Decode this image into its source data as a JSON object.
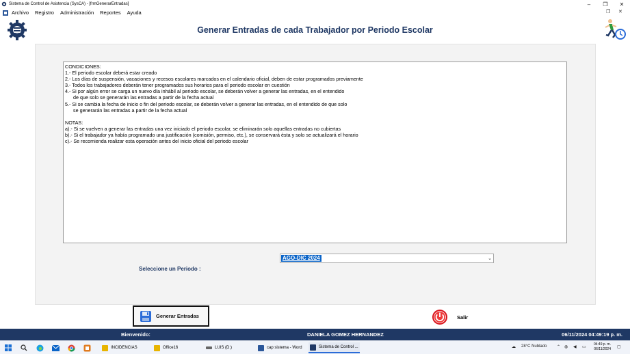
{
  "window": {
    "title": "Sistema de Control de Asistencia (SysCA) - [frmGenerarEntradas]",
    "icon": "app-icon",
    "controls": [
      "minimize-icon",
      "restore-icon",
      "close-icon"
    ]
  },
  "menu": {
    "items": [
      "Archivo",
      "Registro",
      "Administración",
      "Reportes",
      "Ayuda"
    ]
  },
  "header": {
    "title": "Generar Entradas de cada Trabajador por Periodo Escolar",
    "title_color": "#1f3864"
  },
  "conditions_text": "CONDICIONES:\n1.- El periodo escolar deberá estar creado\n2.- Los días de suspensión, vacaciones y recesos escolares marcados en el calendario oficial, deben de estar programados previamente\n3.- Todos los trabajadores deberán tener programados sus horarios para el periodo escolar en cuestión\n4.- Si por algún error se carga un nuevo día inhábil al periodo escolar, se deberán volver a generar las entradas, en el entendido\n      de que solo se generarán las entradas a partir de la fecha actual\n5.- Si se cambia la fecha de inicio o fin del periodo escolar, se deberán volver a generar las entradas, en el entendido de que solo\n      se generarán las entradas a partir de la fecha actual\n\nNOTAS:\na).- Si se vuelven a generar las entradas una vez iniciado el periodo escolar, se eliminarán solo aquellas entradas no cubiertas\nb).- Si el trabajador ya había programado una justificación (comisión, permiso, etc.), se conservará ésta y solo se actualizará el horario\nc).- Se recomienda realizar esta operación antes del inicio oficial del periodo escolar",
  "periodo": {
    "label": "Seleccione un Periodo :",
    "selected": "AGO-DIC 2024"
  },
  "buttons": {
    "generar": "Generar Entradas",
    "salir": "Salir"
  },
  "status": {
    "welcome_label": "Bienvenido:",
    "user": "DANIELA GOMEZ HERNANDEZ",
    "datetime": "06/11/2024 04:49:19 p. m."
  },
  "taskbar": {
    "apps": [
      {
        "label": "INCIDENCIAS",
        "color": "#e8b400"
      },
      {
        "label": "Office16",
        "color": "#e8b400"
      },
      {
        "label": "LUIS (D:)",
        "color": "#666666"
      },
      {
        "label": "cap sistema - Word",
        "color": "#2b579a"
      },
      {
        "label": "Sistema de Control ...",
        "color": "#1f3864"
      }
    ],
    "weather": "28°C  Nublado",
    "time": "04:49 p. m.",
    "date": "06/11/2024"
  },
  "colors": {
    "status_bar": "#1f3864",
    "selection": "#0a64c8",
    "salir_red": "#d9141c"
  }
}
